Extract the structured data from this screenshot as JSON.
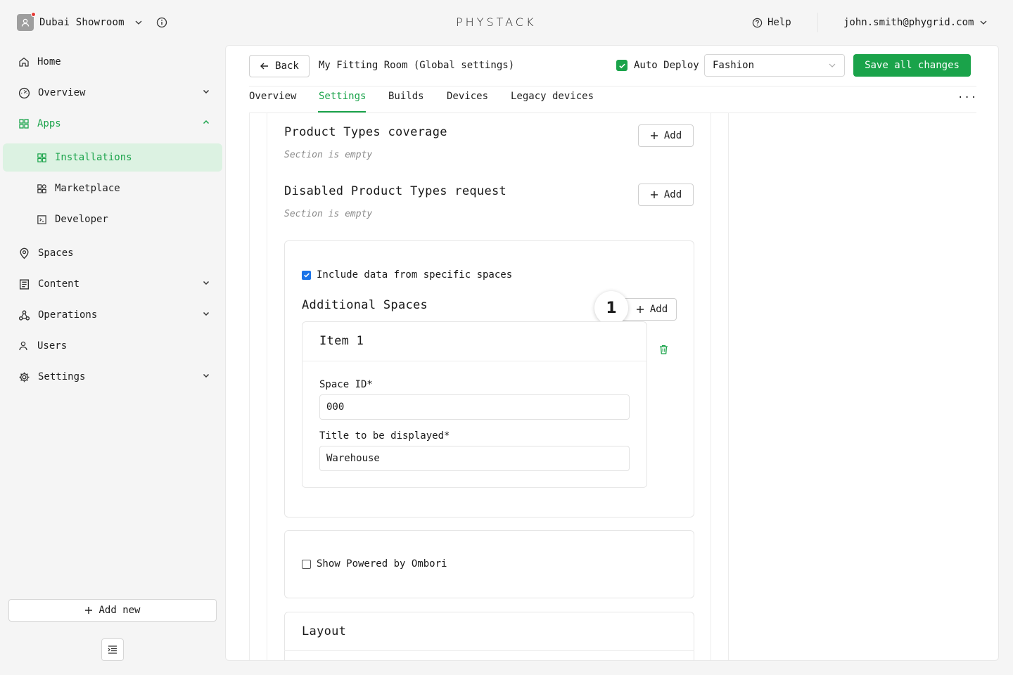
{
  "workspace": {
    "name": "Dubai Showroom"
  },
  "logo": {
    "text": "PHYSTACK"
  },
  "header": {
    "help_label": "Help",
    "user_email": "john.smith@phygrid.com"
  },
  "sidebar": {
    "items": [
      {
        "label": "Home",
        "icon": "home-icon"
      },
      {
        "label": "Overview",
        "icon": "dashboard-icon",
        "expandable": true
      },
      {
        "label": "Apps",
        "icon": "apps-icon",
        "expandable": true,
        "expanded": true,
        "active": true
      },
      {
        "label": "Spaces",
        "icon": "location-pin-icon"
      },
      {
        "label": "Content",
        "icon": "content-icon",
        "expandable": true
      },
      {
        "label": "Operations",
        "icon": "operations-icon",
        "expandable": true
      },
      {
        "label": "Users",
        "icon": "users-icon"
      },
      {
        "label": "Settings",
        "icon": "gear-icon",
        "expandable": true
      }
    ],
    "apps_children": [
      {
        "label": "Installations",
        "icon": "grid-icon",
        "active": true
      },
      {
        "label": "Marketplace",
        "icon": "marketplace-icon"
      },
      {
        "label": "Developer",
        "icon": "terminal-icon"
      }
    ],
    "add_new_label": "Add new"
  },
  "toolbar": {
    "back_label": "Back",
    "page_title": "My Fitting Room (Global settings)",
    "auto_deploy_label": "Auto Deploy",
    "auto_deploy_checked": true,
    "select_value": "Fashion",
    "save_label": "Save all changes"
  },
  "tabs": [
    {
      "label": "Overview"
    },
    {
      "label": "Settings",
      "active": true
    },
    {
      "label": "Builds"
    },
    {
      "label": "Devices"
    },
    {
      "label": "Legacy devices"
    }
  ],
  "more_label": "...",
  "sections": {
    "product_types": {
      "title": "Product Types coverage",
      "empty": "Section is empty",
      "add_label": "Add"
    },
    "disabled_types": {
      "title": "Disabled Product Types request",
      "empty": "Section is empty",
      "add_label": "Add"
    }
  },
  "spaces_card": {
    "include_label": "Include data from specific spaces",
    "include_checked": true,
    "additional_title": "Additional Spaces",
    "add_label": "Add",
    "step_badge": "1",
    "item": {
      "title": "Item 1",
      "space_id_label": "Space ID*",
      "space_id_value": "000",
      "title_label": "Title to be displayed*",
      "title_value": "Warehouse"
    }
  },
  "powered_card": {
    "label": "Show Powered by Ombori",
    "checked": false
  },
  "layout_card": {
    "title": "Layout"
  },
  "colors": {
    "accent": "#1aa34a",
    "accent_bg": "#dcf2e2",
    "checkbox_blue": "#1a73e8",
    "trash": "#1aa34a"
  }
}
